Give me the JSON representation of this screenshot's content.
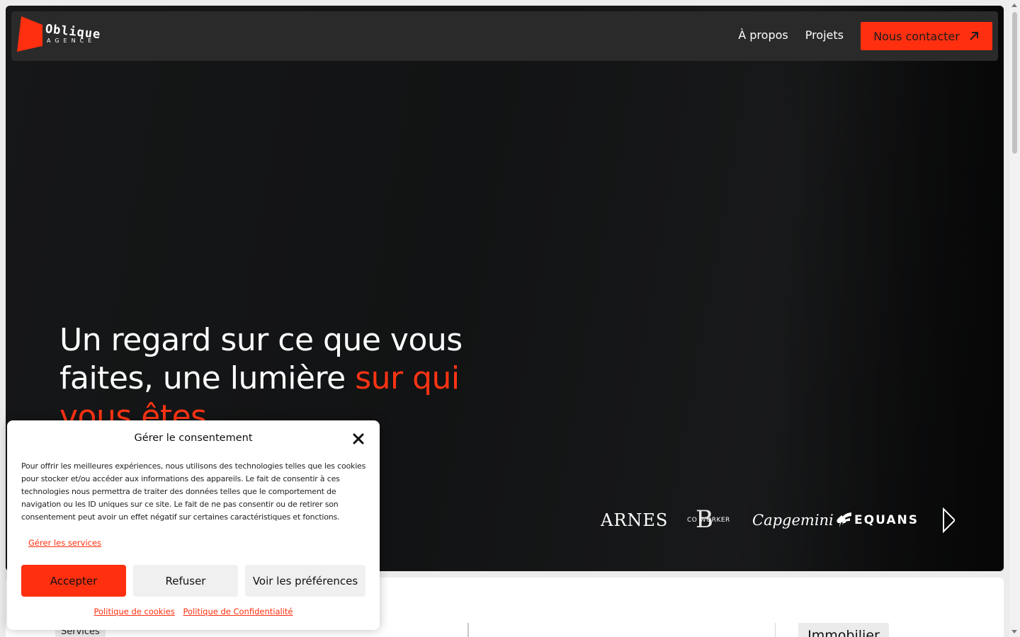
{
  "brand": {
    "logo_word": "Oblique",
    "logo_sub": "AGENCE",
    "accent_color": "#ff2f0f"
  },
  "nav": {
    "links": [
      "À propos",
      "Projets"
    ],
    "contact_label": "Nous contacter"
  },
  "hero": {
    "title_line1": "Un regard sur ce que vous",
    "title_line2_white": "faites, une lumière ",
    "title_line2_accent": "sur qui",
    "title_line3_accent": "vous êtes"
  },
  "clients": {
    "barnes": "ARNES",
    "coworker": "CO WORKER",
    "coworker_mark": "B",
    "capgemini": "Capgemini",
    "equans": "EQUANS"
  },
  "below_fold": {
    "services_tag": "Services",
    "immobilier_tag": "Immobilier"
  },
  "consent": {
    "title": "Gérer le consentement",
    "body": "Pour offrir les meilleures expériences, nous utilisons des technologies telles que les cookies pour stocker et/ou accéder aux informations des appareils. Le fait de consentir à ces technologies nous permettra de traiter des données telles que le comportement de navigation ou les ID uniques sur ce site. Le fait de ne pas consentir ou de retirer son consentement peut avoir un effet négatif sur certaines caractéristiques et fonctions.",
    "manage_services": "Gérer les services",
    "accept": "Accepter",
    "refuse": "Refuser",
    "preferences": "Voir les préférences",
    "cookie_policy": "Politique de cookies",
    "privacy_policy": "Politique de Confidentialité"
  }
}
